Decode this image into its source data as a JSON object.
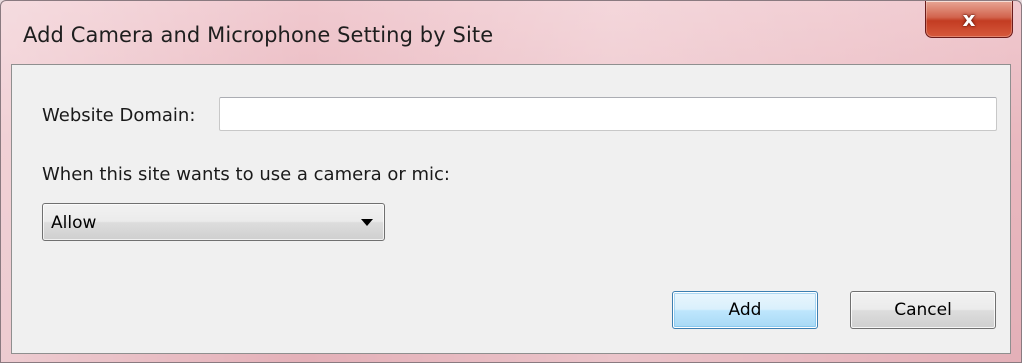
{
  "dialog": {
    "title": "Add Camera and Microphone Setting by Site",
    "close_label": "x"
  },
  "form": {
    "domain_label": "Website Domain:",
    "domain_value": "",
    "domain_placeholder": "",
    "permission_label": "When this site wants to use a camera or mic:",
    "permission_selected": "Allow"
  },
  "buttons": {
    "add_label": "Add",
    "cancel_label": "Cancel"
  },
  "icons": {
    "close": "close-icon",
    "dropdown": "chevron-down-icon"
  },
  "colors": {
    "default_button_border": "#3c7fb1",
    "close_button": "#c33c22",
    "client_background": "#f0f0f0"
  }
}
